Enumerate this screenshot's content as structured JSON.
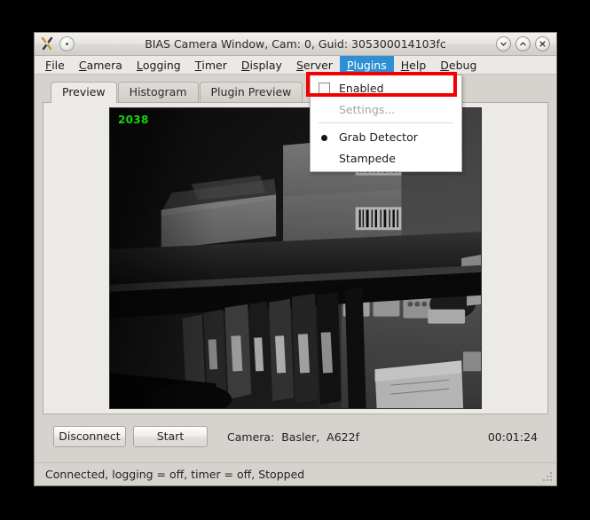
{
  "window": {
    "title": "BIAS Camera Window, Cam: 0, Guid: 305300014103fc",
    "app_icon": "bias-app-icon",
    "menu_button_icon": "window-menu-icon",
    "controls": [
      {
        "name": "minimize-button",
        "icon": "chevron-down-icon"
      },
      {
        "name": "maximize-button",
        "icon": "chevron-up-icon"
      },
      {
        "name": "close-button",
        "icon": "close-x-icon"
      }
    ]
  },
  "menubar": {
    "items": [
      {
        "label": "File",
        "mnemonic": "F"
      },
      {
        "label": "Camera",
        "mnemonic": "C"
      },
      {
        "label": "Logging",
        "mnemonic": "L"
      },
      {
        "label": "Timer",
        "mnemonic": "T"
      },
      {
        "label": "Display",
        "mnemonic": "D"
      },
      {
        "label": "Server",
        "mnemonic": "S"
      },
      {
        "label": "Plugins",
        "mnemonic": "P",
        "active": true
      },
      {
        "label": "Help",
        "mnemonic": "H"
      },
      {
        "label": "Debug",
        "mnemonic": "D"
      }
    ],
    "active_label": "Plugins",
    "active_color": "#2f8fd4"
  },
  "plugins_menu": {
    "items": [
      {
        "label": "Enabled",
        "type": "checkbox",
        "checked": false,
        "enabled": true,
        "highlighted": true
      },
      {
        "label": "Settings...",
        "type": "action",
        "enabled": false
      },
      {
        "label": "Grab Detector",
        "type": "radio",
        "selected": true,
        "enabled": true
      },
      {
        "label": "Stampede",
        "type": "radio",
        "selected": false,
        "enabled": true
      }
    ]
  },
  "annotation": {
    "type": "highlight-rectangle",
    "target": "Enabled",
    "color": "#f40000"
  },
  "tabs": [
    {
      "label": "Preview",
      "active": true
    },
    {
      "label": "Histogram",
      "active": false
    },
    {
      "label": "Plugin Preview",
      "active": false
    }
  ],
  "preview": {
    "frame_counter": "2038",
    "frame_counter_color": "#15d415",
    "scene_description": "grayscale-camera-feed-shelves-with-boxes-and-binders"
  },
  "controls": {
    "disconnect_label": "Disconnect",
    "start_label": "Start",
    "camera_info": "Camera:  Basler,  A622f",
    "elapsed_time": "00:01:24"
  },
  "status": {
    "text": "Connected, logging = off, timer = off, Stopped",
    "resize_grip_icon": "resize-grip-icon"
  }
}
